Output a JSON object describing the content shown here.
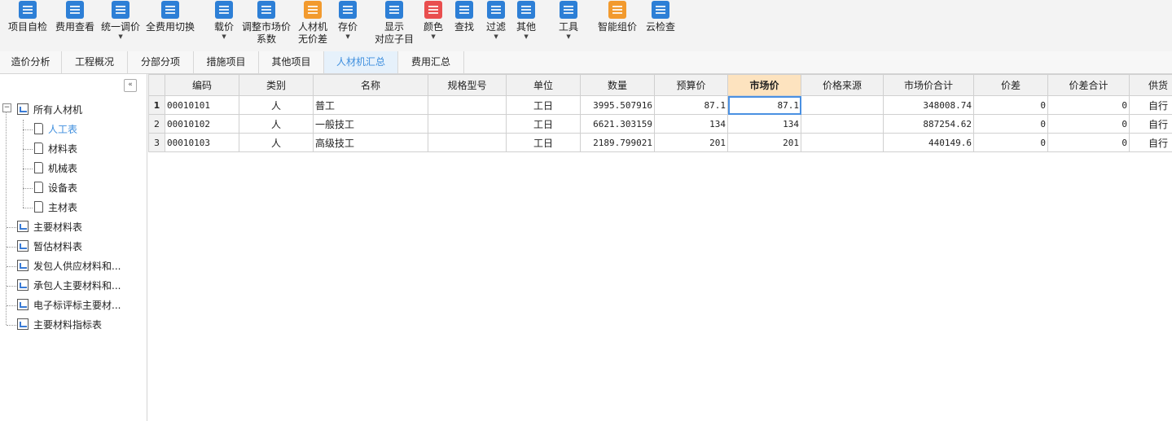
{
  "toolbar": {
    "buttons": [
      {
        "l1": "项目自检",
        "icon": "inspect-icon"
      },
      {
        "l1": "费用查看",
        "icon": "fee-view-icon"
      },
      {
        "l1": "统一调价",
        "icon": "adjust-price-icon"
      },
      {
        "l1": "全费用切换",
        "icon": "switch-icon"
      },
      {
        "l1": "载价",
        "icon": "load-price-icon"
      },
      {
        "l1": "调整市场价",
        "l2": "系数",
        "icon": "coefficient-icon"
      },
      {
        "l1": "人材机",
        "l2": "无价差",
        "icon": "balance-icon"
      },
      {
        "l1": "存价",
        "icon": "save-price-icon"
      },
      {
        "l1": "显示",
        "l2": "对应子目",
        "icon": "show-items-icon"
      },
      {
        "l1": "颜色",
        "icon": "color-icon"
      },
      {
        "l1": "查找",
        "icon": "find-icon"
      },
      {
        "l1": "过滤",
        "icon": "filter-icon"
      },
      {
        "l1": "其他",
        "icon": "other-icon"
      },
      {
        "l1": "工具",
        "icon": "tools-icon"
      },
      {
        "l1": "智能组价",
        "icon": "smart-price-icon"
      },
      {
        "l1": "云检查",
        "icon": "cloud-check-icon"
      }
    ]
  },
  "tabs": [
    "造价分析",
    "工程概况",
    "分部分项",
    "措施项目",
    "其他项目",
    "人材机汇总",
    "费用汇总"
  ],
  "tree": {
    "root": "所有人材机",
    "children": [
      "人工表",
      "材料表",
      "机械表",
      "设备表",
      "主材表"
    ],
    "others": [
      "主要材料表",
      "暂估材料表",
      "发包人供应材料和...",
      "承包人主要材料和...",
      "电子标评标主要材...",
      "主要材料指标表"
    ]
  },
  "table": {
    "headers": [
      "编码",
      "类别",
      "名称",
      "规格型号",
      "单位",
      "数量",
      "预算价",
      "市场价",
      "价格来源",
      "市场价合计",
      "价差",
      "价差合计",
      "供货"
    ],
    "rows": [
      [
        "1",
        "00010101",
        "人",
        "普工",
        "",
        "工日",
        "3995.507916",
        "87.1",
        "87.1",
        "",
        "348008.74",
        "0",
        "0",
        "自行"
      ],
      [
        "2",
        "00010102",
        "人",
        "一般技工",
        "",
        "工日",
        "6621.303159",
        "134",
        "134",
        "",
        "887254.62",
        "0",
        "0",
        "自行"
      ],
      [
        "3",
        "00010103",
        "人",
        "高级技工",
        "",
        "工日",
        "2189.799021",
        "201",
        "201",
        "",
        "440149.6",
        "0",
        "0",
        "自行"
      ]
    ]
  },
  "colors": {
    "accent": "#3d8ede",
    "header_highlight": "#fde3bf"
  }
}
